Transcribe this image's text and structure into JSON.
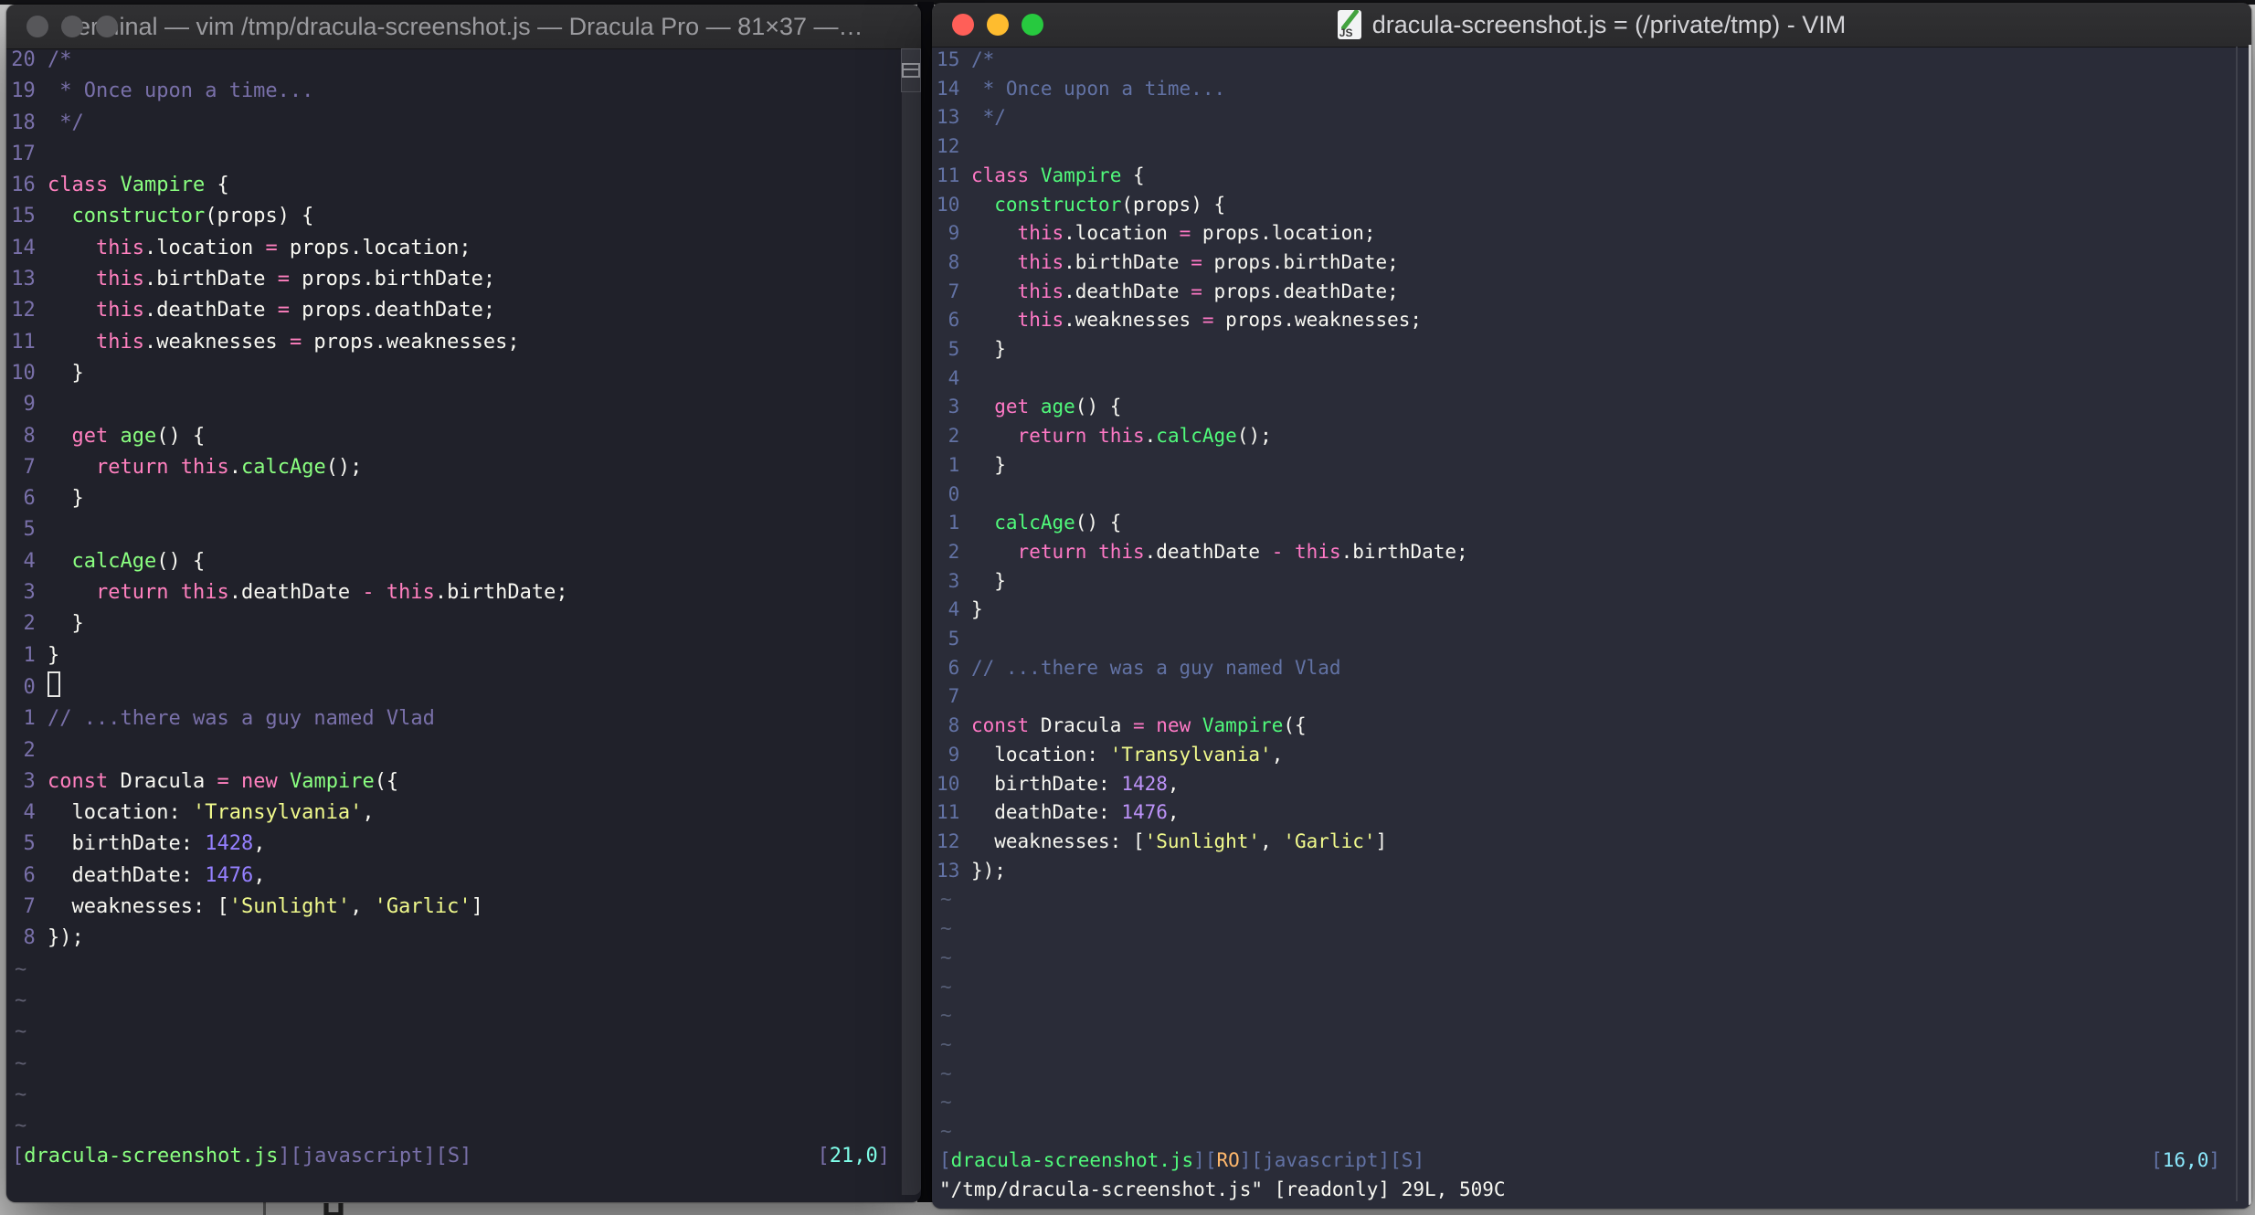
{
  "left_window": {
    "titlebar": {
      "title": "Terminal — vim /tmp/dracula-screenshot.js — Dracula Pro — 81×37 —…",
      "traffic_lights": "inactive-gray"
    },
    "colors": {
      "bg": "#20212a",
      "fg": "#f8f8f2",
      "comment": "#7970a9",
      "pink": "#ff80bf",
      "green": "#8aff80",
      "yellow": "#f1fa8c",
      "purple": "#9580ff",
      "cyan": "#80ffea",
      "tilde": "#5e5e70"
    },
    "rel_numbers": [
      20,
      19,
      18,
      17,
      16,
      15,
      14,
      13,
      12,
      11,
      10,
      9,
      8,
      7,
      6,
      5,
      4,
      3,
      2,
      1,
      0,
      1,
      2,
      3,
      4,
      5,
      6,
      7,
      8
    ],
    "cursor_line_index": 20,
    "tilde_count": 6,
    "status_left": [
      [
        "br",
        "["
      ],
      [
        "file",
        "dracula-screenshot.js"
      ],
      [
        "br",
        "]["
      ],
      [
        "br",
        "javascript"
      ],
      [
        "br",
        "]["
      ],
      [
        "br",
        "S"
      ],
      [
        "br",
        "]"
      ]
    ],
    "status_right": [
      [
        "br",
        "["
      ],
      [
        "pos",
        "21,0"
      ],
      [
        "br",
        "]"
      ]
    ],
    "cmdline": ""
  },
  "right_window": {
    "titlebar": {
      "title": "dracula-screenshot.js = (/private/tmp) - VIM",
      "icon": "js-document-icon",
      "traffic_lights": "active-red-yellow-green"
    },
    "colors": {
      "bg": "#2a2c38",
      "fg": "#f8f8f2",
      "comment": "#6272a4",
      "pink": "#ff79c6",
      "green": "#50fa7b",
      "yellow": "#f1fa8c",
      "purple": "#bd93f9",
      "cyan": "#8be9fd",
      "orange": "#ffb86c",
      "tilde": "#555d75"
    },
    "rel_numbers": [
      15,
      14,
      13,
      12,
      11,
      10,
      9,
      8,
      7,
      6,
      5,
      4,
      3,
      2,
      1,
      0,
      1,
      2,
      3,
      4,
      5,
      6,
      7,
      8,
      9,
      10,
      11,
      12,
      13
    ],
    "cursor_line_index": null,
    "tilde_count": 9,
    "status_left": [
      [
        "br",
        "["
      ],
      [
        "file",
        "dracula-screenshot.js"
      ],
      [
        "br",
        "]["
      ],
      [
        "ro",
        "RO"
      ],
      [
        "br",
        "]["
      ],
      [
        "br",
        "javascript"
      ],
      [
        "br",
        "]["
      ],
      [
        "br",
        "S"
      ],
      [
        "br",
        "]"
      ]
    ],
    "status_right": [
      [
        "br",
        "["
      ],
      [
        "pos",
        "16,0"
      ],
      [
        "br",
        "]"
      ]
    ],
    "cmdline": "\"/tmp/dracula-screenshot.js\" [readonly] 29L, 509C"
  },
  "tilde": "~",
  "code_lines": [
    [
      [
        "c",
        "/*"
      ]
    ],
    [
      [
        "c",
        " * Once upon a time..."
      ]
    ],
    [
      [
        "c",
        " */"
      ]
    ],
    [],
    [
      [
        "k",
        "class"
      ],
      [
        "d",
        " "
      ],
      [
        "f",
        "Vampire"
      ],
      [
        "d",
        " {"
      ]
    ],
    [
      [
        "d",
        "  "
      ],
      [
        "f",
        "constructor"
      ],
      [
        "d",
        "(props) {"
      ]
    ],
    [
      [
        "d",
        "    "
      ],
      [
        "k",
        "this"
      ],
      [
        "d",
        ".location "
      ],
      [
        "k",
        "="
      ],
      [
        "d",
        " props.location;"
      ]
    ],
    [
      [
        "d",
        "    "
      ],
      [
        "k",
        "this"
      ],
      [
        "d",
        ".birthDate "
      ],
      [
        "k",
        "="
      ],
      [
        "d",
        " props.birthDate;"
      ]
    ],
    [
      [
        "d",
        "    "
      ],
      [
        "k",
        "this"
      ],
      [
        "d",
        ".deathDate "
      ],
      [
        "k",
        "="
      ],
      [
        "d",
        " props.deathDate;"
      ]
    ],
    [
      [
        "d",
        "    "
      ],
      [
        "k",
        "this"
      ],
      [
        "d",
        ".weaknesses "
      ],
      [
        "k",
        "="
      ],
      [
        "d",
        " props.weaknesses;"
      ]
    ],
    [
      [
        "d",
        "  }"
      ]
    ],
    [],
    [
      [
        "d",
        "  "
      ],
      [
        "k",
        "get"
      ],
      [
        "d",
        " "
      ],
      [
        "f",
        "age"
      ],
      [
        "d",
        "() {"
      ]
    ],
    [
      [
        "d",
        "    "
      ],
      [
        "k",
        "return"
      ],
      [
        "d",
        " "
      ],
      [
        "k",
        "this"
      ],
      [
        "d",
        "."
      ],
      [
        "f",
        "calcAge"
      ],
      [
        "d",
        "();"
      ]
    ],
    [
      [
        "d",
        "  }"
      ]
    ],
    [],
    [
      [
        "d",
        "  "
      ],
      [
        "f",
        "calcAge"
      ],
      [
        "d",
        "() {"
      ]
    ],
    [
      [
        "d",
        "    "
      ],
      [
        "k",
        "return"
      ],
      [
        "d",
        " "
      ],
      [
        "k",
        "this"
      ],
      [
        "d",
        ".deathDate "
      ],
      [
        "k",
        "-"
      ],
      [
        "d",
        " "
      ],
      [
        "k",
        "this"
      ],
      [
        "d",
        ".birthDate;"
      ]
    ],
    [
      [
        "d",
        "  }"
      ]
    ],
    [
      [
        "d",
        "}"
      ]
    ],
    [],
    [
      [
        "c",
        "// ...there was a guy named Vlad"
      ]
    ],
    [],
    [
      [
        "k",
        "const"
      ],
      [
        "d",
        " Dracula "
      ],
      [
        "k",
        "="
      ],
      [
        "d",
        " "
      ],
      [
        "k",
        "new"
      ],
      [
        "d",
        " "
      ],
      [
        "f",
        "Vampire"
      ],
      [
        "d",
        "({"
      ]
    ],
    [
      [
        "d",
        "  location: "
      ],
      [
        "s",
        "'Transylvania'"
      ],
      [
        "d",
        ","
      ]
    ],
    [
      [
        "d",
        "  birthDate: "
      ],
      [
        "n",
        "1428"
      ],
      [
        "d",
        ","
      ]
    ],
    [
      [
        "d",
        "  deathDate: "
      ],
      [
        "n",
        "1476"
      ],
      [
        "d",
        ","
      ]
    ],
    [
      [
        "d",
        "  weaknesses: ["
      ],
      [
        "s",
        "'Sunlight'"
      ],
      [
        "d",
        ", "
      ],
      [
        "s",
        "'Garlic'"
      ],
      [
        "d",
        "]"
      ]
    ],
    [
      [
        "d",
        "});"
      ]
    ]
  ],
  "background": {
    "partial_text": "H"
  }
}
